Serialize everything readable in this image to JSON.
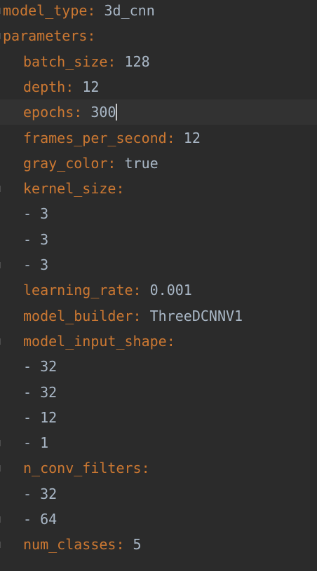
{
  "lines": [
    {
      "type": "kv",
      "indent": 0,
      "key": "model_type",
      "sep": ":",
      "value": "3d_cnn"
    },
    {
      "type": "section",
      "indent": 0,
      "key": "parameters",
      "sep": ":"
    },
    {
      "type": "kv",
      "indent": 1,
      "key": "batch_size",
      "sep": ":",
      "value": "128"
    },
    {
      "type": "kv",
      "indent": 1,
      "key": "depth",
      "sep": ":",
      "value": "12"
    },
    {
      "type": "kv",
      "indent": 1,
      "key": "epochs",
      "sep": ":",
      "value": "300",
      "caret": true
    },
    {
      "type": "kv",
      "indent": 1,
      "key": "frames_per_second",
      "sep": ":",
      "value": "12"
    },
    {
      "type": "kv",
      "indent": 1,
      "key": "gray_color",
      "sep": ":",
      "value": "true"
    },
    {
      "type": "section",
      "indent": 1,
      "key": "kernel_size",
      "sep": ":"
    },
    {
      "type": "item",
      "indent": 1,
      "dash": "-",
      "value": "3"
    },
    {
      "type": "item",
      "indent": 1,
      "dash": "-",
      "value": "3"
    },
    {
      "type": "item",
      "indent": 1,
      "dash": "-",
      "value": "3"
    },
    {
      "type": "kv",
      "indent": 1,
      "key": "learning_rate",
      "sep": ":",
      "value": "0.001"
    },
    {
      "type": "kv",
      "indent": 1,
      "key": "model_builder",
      "sep": ":",
      "value": "ThreeDCNNV1"
    },
    {
      "type": "section",
      "indent": 1,
      "key": "model_input_shape",
      "sep": ":"
    },
    {
      "type": "item",
      "indent": 1,
      "dash": "-",
      "value": "32"
    },
    {
      "type": "item",
      "indent": 1,
      "dash": "-",
      "value": "32"
    },
    {
      "type": "item",
      "indent": 1,
      "dash": "-",
      "value": "12"
    },
    {
      "type": "item",
      "indent": 1,
      "dash": "-",
      "value": "1"
    },
    {
      "type": "section",
      "indent": 1,
      "key": "n_conv_filters",
      "sep": ":"
    },
    {
      "type": "item",
      "indent": 1,
      "dash": "-",
      "value": "32"
    },
    {
      "type": "item",
      "indent": 1,
      "dash": "-",
      "value": "64"
    },
    {
      "type": "kv",
      "indent": 1,
      "key": "num_classes",
      "sep": ":",
      "value": "5"
    }
  ],
  "colors": {
    "background": "#2b2b2b",
    "current_line": "#323232",
    "key": "#cc7832",
    "value": "#a9b7c6",
    "caret": "#c8c8c8"
  }
}
